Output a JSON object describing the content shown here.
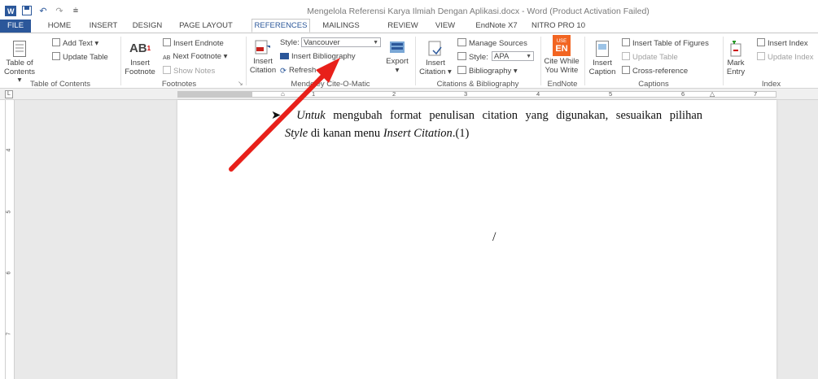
{
  "window": {
    "title": "Mengelola Referensi Karya Ilmiah Dengan Aplikasi.docx - Word (Product Activation Failed)"
  },
  "tabs": [
    "FILE",
    "HOME",
    "INSERT",
    "DESIGN",
    "PAGE LAYOUT",
    "REFERENCES",
    "MAILINGS",
    "REVIEW",
    "VIEW",
    "EndNote X7",
    "NITRO PRO 10"
  ],
  "active_tab": "REFERENCES",
  "ribbon": {
    "toc": {
      "table_of_contents": "Table of Contents",
      "add_text": "Add Text",
      "update_table": "Update Table",
      "label": "Table of Contents"
    },
    "footnotes": {
      "insert_footnote": "Insert Footnote",
      "insert_endnote": "Insert Endnote",
      "next_footnote": "Next Footnote",
      "show_notes": "Show Notes",
      "label": "Footnotes"
    },
    "cite_o_matic": {
      "insert_citation": "Insert Citation",
      "style_label": "Style:",
      "style_value": "Vancouver",
      "insert_bibliography": "Insert Bibliography",
      "refresh": "Refresh",
      "export": "Export",
      "label": "Mendeley Cite-O-Matic"
    },
    "citations": {
      "insert_citation": "Insert Citation",
      "manage_sources": "Manage Sources",
      "style_label": "Style:",
      "style_value": "APA",
      "bibliography": "Bibliography",
      "label": "Citations & Bibliography"
    },
    "endnote": {
      "cite_while_you_write": "Cite While You Write",
      "logo_text": "EN",
      "logo_top": "USE",
      "label": "EndNote"
    },
    "captions": {
      "insert_caption": "Insert Caption",
      "insert_table_of_figures": "Insert Table of Figures",
      "update_table": "Update Table",
      "cross_reference": "Cross-reference",
      "label": "Captions"
    },
    "index": {
      "mark_entry": "Mark Entry",
      "insert_index": "Insert Index",
      "update_index": "Update Index",
      "label": "Index"
    }
  },
  "ruler": {
    "marks": [
      "1",
      "2",
      "3",
      "4",
      "5",
      "6",
      "7"
    ],
    "vmarks": [
      "4",
      "5",
      "6",
      "7"
    ]
  },
  "document": {
    "bullet": "➤",
    "line1_italic": "Untuk",
    "line1_rest": " mengubah format penulisan citation yang digunakan, sesuaikan pilihan",
    "line2_italic1": "Style",
    "line2_mid": " di kanan menu ",
    "line2_italic2": "Insert Citation",
    "line2_end": ".(1)",
    "cursor_glyph": "/"
  },
  "colors": {
    "accent": "#2b579a",
    "arrow": "#e8201a"
  }
}
